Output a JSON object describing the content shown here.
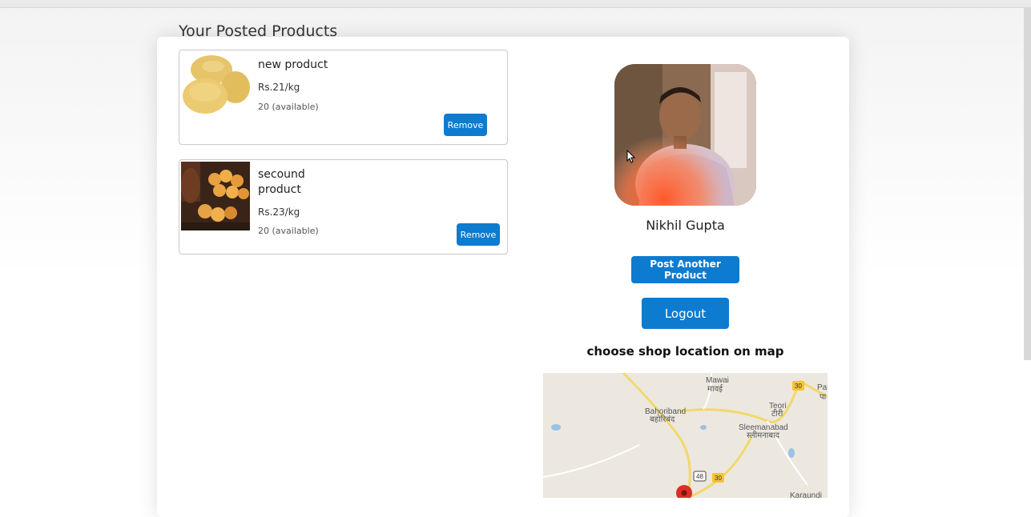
{
  "section_title": "Your Posted Products",
  "products": [
    {
      "name": "new product",
      "price": "Rs.21/kg",
      "availability": "20 (available)",
      "remove_label": "Remove",
      "image": "potatoes"
    },
    {
      "name": "secound product",
      "price": "Rs.23/kg",
      "availability": "20 (available)",
      "remove_label": "Remove",
      "image": "sweets"
    }
  ],
  "profile": {
    "name": "Nikhil Gupta",
    "post_button_label": "Post Another Product",
    "logout_label": "Logout"
  },
  "map": {
    "title": "choose shop location on map",
    "places": [
      {
        "name": "Mawai",
        "local": "मावई"
      },
      {
        "name": "Bahoriband",
        "local": "बहोरिबंद"
      },
      {
        "name": "Teori",
        "local": "टीरी"
      },
      {
        "name": "Sleemanabad",
        "local": "स्लीमनाबाद"
      },
      {
        "name": "Pal",
        "local": "पा"
      },
      {
        "name": "Karaundi",
        "local": ""
      }
    ],
    "road_shields": [
      "30",
      "48",
      "30"
    ]
  },
  "colors": {
    "primary": "#0d7bd0",
    "marker": "#d93025"
  }
}
